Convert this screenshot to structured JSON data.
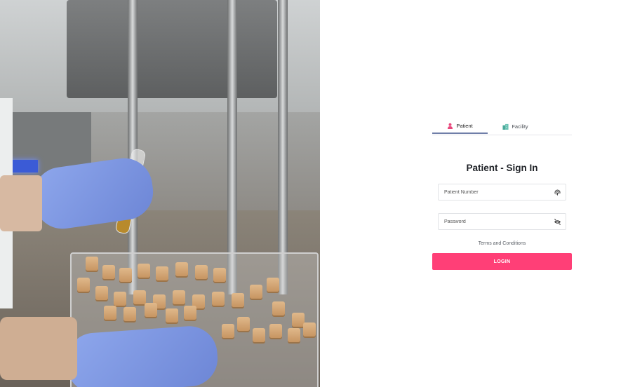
{
  "tabs": [
    {
      "label": "Patient",
      "icon": "person-icon",
      "active": true
    },
    {
      "label": "Facility",
      "icon": "building-icon",
      "active": false
    }
  ],
  "title": "Patient - Sign In",
  "fields": {
    "patient_number": {
      "placeholder": "Patient Number",
      "value": "",
      "icon": "fingerprint-icon"
    },
    "password": {
      "placeholder": "Password",
      "value": "",
      "icon": "eye-off-icon"
    }
  },
  "terms_label": "Terms and Conditions",
  "login_label": "LOGIN",
  "colors": {
    "accent": "#ff3f77",
    "tab_indicator": "#6f7ea8",
    "patient_icon": "#e8477c",
    "facility_icon": "#4aa99a"
  }
}
